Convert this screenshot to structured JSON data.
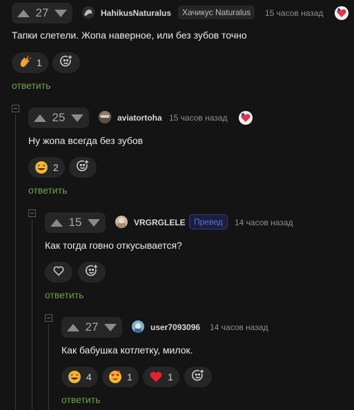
{
  "comments": [
    {
      "votes": "27",
      "username": "HahikusNaturalus",
      "badge": "Хачикус Naturalus",
      "time": "15 часов назад",
      "text": "Тапки слетели. Жопа наверное, или без зубов точно",
      "reactions": [
        {
          "icon": "clap-emoji-icon",
          "count": "1"
        }
      ],
      "reply_label": "ответить"
    },
    {
      "votes": "25",
      "username": "aviatortoha",
      "time": "15 часов назад",
      "text": "Ну жопа всегда без зубов",
      "reactions": [
        {
          "icon": "laughing-emoji-icon",
          "count": "2"
        }
      ],
      "reply_label": "ответить"
    },
    {
      "votes": "15",
      "username": "VRGRGLELE",
      "badge": "Превед",
      "time": "14 часов назад",
      "text": "Как тогда говно откусывается?",
      "reactions": [
        {
          "icon": "heart-outline-icon",
          "count": ""
        }
      ],
      "reply_label": "ответить"
    },
    {
      "votes": "27",
      "username": "user7093096",
      "time": "14 часов назад",
      "text": "Как бабушка котлетку, милок.",
      "reactions": [
        {
          "icon": "laughing-emoji-icon",
          "count": "4"
        },
        {
          "icon": "heart-eyes-emoji-icon",
          "count": "1"
        },
        {
          "icon": "red-heart-icon",
          "count": "1"
        }
      ],
      "reply_label": "ответить"
    }
  ],
  "colors": {
    "background": "#141414",
    "surface": "#262626",
    "reply": "#6fa34a",
    "badge_blue_text": "#5b6fe6",
    "badge_blue_border": "#2e3a8a"
  }
}
